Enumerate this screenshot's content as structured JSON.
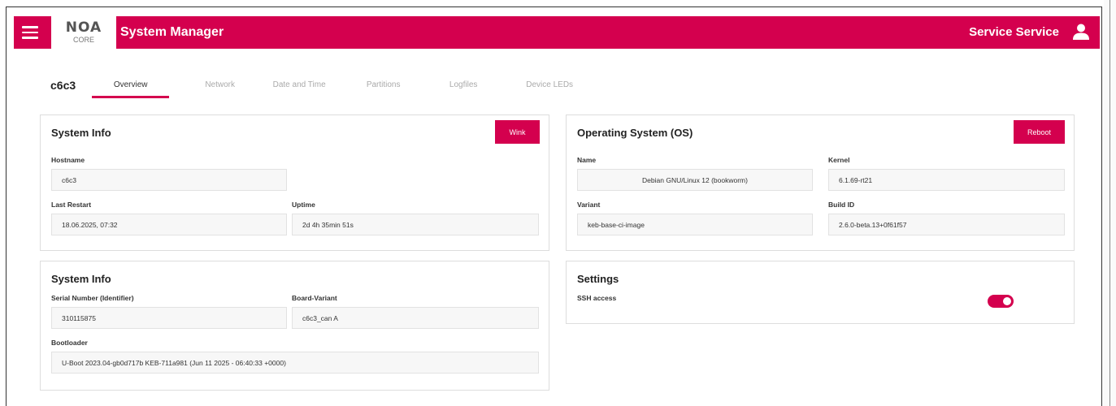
{
  "header": {
    "logo_main": "NOA",
    "logo_sub": "CORE",
    "title": "System Manager",
    "user_name": "Service Service",
    "accent_color": "#d4004e"
  },
  "device": {
    "name": "c6c3"
  },
  "tabs": [
    {
      "label": "Overview",
      "active": true
    },
    {
      "label": "Network",
      "active": false
    },
    {
      "label": "Date and Time",
      "active": false
    },
    {
      "label": "Partitions",
      "active": false
    },
    {
      "label": "Logfiles",
      "active": false
    },
    {
      "label": "Device LEDs",
      "active": false
    }
  ],
  "system_info": {
    "title": "System Info",
    "wink_label": "Wink",
    "hostname_label": "Hostname",
    "hostname": "c6c3",
    "last_restart_label": "Last Restart",
    "last_restart": "18.06.2025, 07:32",
    "uptime_label": "Uptime",
    "uptime": "2d 4h 35min 51s"
  },
  "os": {
    "title": "Operating System (OS)",
    "reboot_label": "Reboot",
    "name_label": "Name",
    "name": "Debian GNU/Linux 12 (bookworm)",
    "kernel_label": "Kernel",
    "kernel": "6.1.69-rt21",
    "variant_label": "Variant",
    "variant": "keb-base-ci-image",
    "build_id_label": "Build ID",
    "build_id": "2.6.0-beta.13+0f61f57"
  },
  "system_info_2": {
    "title": "System Info",
    "serial_label": "Serial Number (Identifier)",
    "serial": "310115875",
    "board_variant_label": "Board-Variant",
    "board_variant": "c6c3_can A",
    "bootloader_label": "Bootloader",
    "bootloader": "U-Boot 2023.04-gb0d717b KEB-711a981 (Jun 11 2025 - 06:40:33 +0000)"
  },
  "settings": {
    "title": "Settings",
    "ssh_label": "SSH access",
    "ssh_enabled": true
  }
}
